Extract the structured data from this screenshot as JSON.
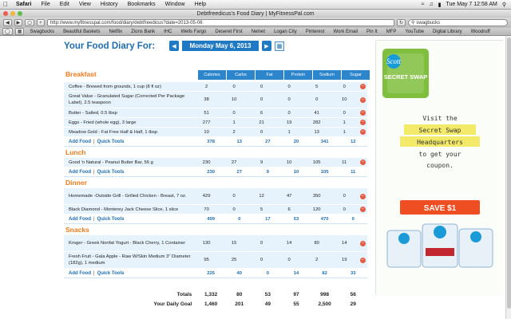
{
  "menubar": {
    "apple_icon": "apple-icon",
    "items": [
      "Safari",
      "File",
      "Edit",
      "View",
      "History",
      "Bookmarks",
      "Window",
      "Help"
    ],
    "clock": "Tue May 7 12:58 AM"
  },
  "window": {
    "title": "Debtfreedicus's Food Diary | MyFitnessPal.com"
  },
  "toolbar": {
    "url": "http://www.myfitnesspal.com/food/diary/debtfreedicus?date=2013-05-06",
    "search_value": "swagbucks"
  },
  "bookmarks": [
    "Swagbucks",
    "Beautiful Baskets",
    "Netflix",
    "Zions Bank",
    "IHC",
    "Wells Fargo",
    "Deseret First",
    "Nelnet",
    "Logan City",
    "Pinterest",
    "Work Email",
    "Pin It",
    "MFP",
    "YouTube",
    "Digital Library",
    "Woodruff"
  ],
  "diary": {
    "title": "Your Food Diary For:",
    "date": "Monday May 6, 2013",
    "columns": [
      "Calories",
      "Carbs",
      "Fat",
      "Protein",
      "Sodium",
      "Sugar"
    ],
    "add_food": "Add Food",
    "quick_tools": "Quick Tools",
    "meals": [
      {
        "name": "Breakfast",
        "foods": [
          {
            "name": "Coffee - Brewed from grounds, 1 cup (8 fl oz)",
            "values": [
              "2",
              "0",
              "0",
              "0",
              "5",
              "0"
            ]
          },
          {
            "name": "Great Value - Granulated Sugar (Corrected Per Package Label), 2.5 teaspoon",
            "values": [
              "38",
              "10",
              "0",
              "0",
              "0",
              "10"
            ]
          },
          {
            "name": "Butter - Salted, 0.5 tbsp",
            "values": [
              "51",
              "0",
              "6",
              "0",
              "41",
              "0"
            ]
          },
          {
            "name": "Eggs - Fried (whole egg), 3 large",
            "values": [
              "277",
              "1",
              "21",
              "19",
              "282",
              "1"
            ]
          },
          {
            "name": "Meadow Gold - Fat Free Half & Half, 1 tbsp",
            "values": [
              "10",
              "2",
              "0",
              "1",
              "13",
              "1"
            ]
          }
        ],
        "totals": [
          "378",
          "13",
          "27",
          "20",
          "341",
          "12"
        ]
      },
      {
        "name": "Lunch",
        "foods": [
          {
            "name": "Good 'n Natural - Peanut Butter Bar, 56 g",
            "values": [
              "230",
              "27",
              "9",
              "10",
              "105",
              "11"
            ]
          }
        ],
        "totals": [
          "230",
          "27",
          "9",
          "10",
          "105",
          "11"
        ]
      },
      {
        "name": "Dinner",
        "foods": [
          {
            "name": "Homemade -Outside Grill - Grilled Chicken - Breast, 7 oz.",
            "values": [
              "429",
              "0",
              "12",
              "47",
              "350",
              "0"
            ]
          },
          {
            "name": "Black Diamond - Monterey Jack Cheese Slice, 1 slice",
            "values": [
              "70",
              "0",
              "5",
              "6",
              "120",
              "0"
            ]
          }
        ],
        "totals": [
          "499",
          "0",
          "17",
          "53",
          "470",
          "0"
        ]
      },
      {
        "name": "Snacks",
        "foods": [
          {
            "name": "Kroger - Greek Nonfat Yogurt - Black Cherry, 1 Container",
            "values": [
              "130",
              "15",
              "0",
              "14",
              "80",
              "14"
            ]
          },
          {
            "name": "Fresh Fruit - Gala Apple - Raw W/Skin Medium 3\" Diameter (182g), 1 medium",
            "values": [
              "95",
              "25",
              "0",
              "0",
              "2",
              "19"
            ]
          }
        ],
        "totals": [
          "225",
          "40",
          "0",
          "14",
          "82",
          "33"
        ]
      }
    ],
    "totals_label": "Totals",
    "totals": [
      "1,332",
      "80",
      "53",
      "97",
      "998",
      "56"
    ],
    "goal_label": "Your Daily Goal",
    "goal": [
      "1,460",
      "201",
      "49",
      "55",
      "2,500",
      "29"
    ]
  },
  "ad": {
    "brand": "Scott",
    "badge": "SECRET SWAP",
    "line1": "Visit the",
    "line2": "Secret Swap",
    "line3": "Headquarters",
    "line4": "to get your",
    "line5": "coupon.",
    "cta": "SAVE $1"
  }
}
